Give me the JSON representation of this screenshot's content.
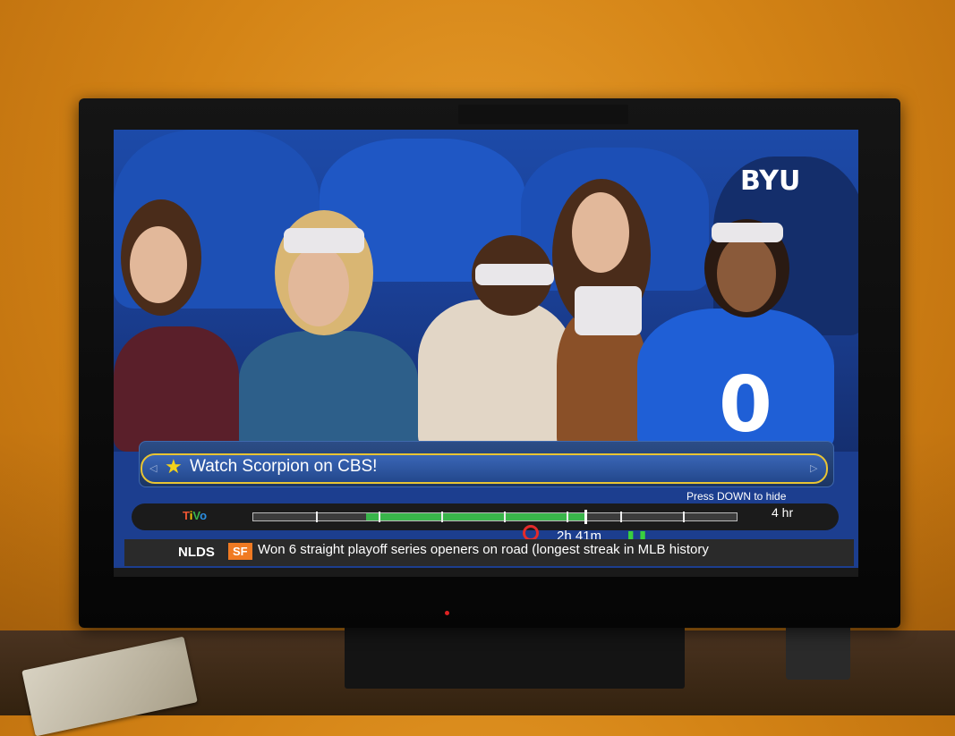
{
  "banner": {
    "message": "Watch Scorpion on CBS!",
    "hint": "Press DOWN to hide"
  },
  "progress": {
    "logo": "TiVo",
    "duration": "4 hr",
    "elapsed": "2h 41m"
  },
  "ticker": {
    "label": "NLDS",
    "team": "SF",
    "text": "Won 6 straight playoff series openers on road (longest streak in MLB history"
  },
  "scene": {
    "shirt_number": "0",
    "logo_text": "BYU"
  },
  "colors": {
    "banner_border": "#e8c433",
    "progress_fill": "#39b54a",
    "ticker_badge": "#f07a22",
    "record": "#e32b2b"
  }
}
